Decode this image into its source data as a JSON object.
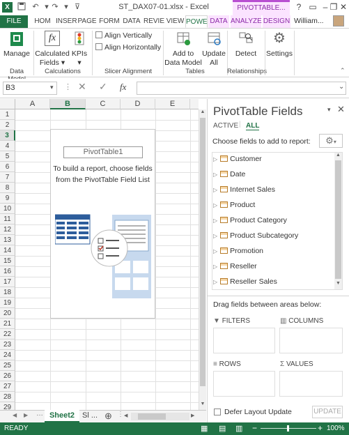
{
  "window": {
    "title": "ST_DAX07-01.xlsx - Excel",
    "context_tab_group": "PIVOTTABLE...",
    "user": "William...",
    "help": "?",
    "minimize": "–",
    "restore": "❐",
    "close": "✕"
  },
  "tabs": [
    "FILE",
    "HOM",
    "INSER",
    "PAGE",
    "FORM",
    "DATA",
    "REVIE",
    "VIEW",
    "POWE",
    "DATA",
    "ANALYZE",
    "DESIGN"
  ],
  "ribbon": {
    "manage": "Manage",
    "data_model": "Data Model",
    "calculated_fields": "Calculated",
    "calculated_fields2": "Fields ▾",
    "kpis": "KPIs",
    "kpis2": "▾",
    "calculations": "Calculations",
    "align_vertically": "Align Vertically",
    "align_horizontally": "Align Horizontally",
    "slicer_alignment": "Slicer Alignment",
    "add_to_data_model": "Add to",
    "add_to_data_model2": "Data Model",
    "update_all": "Update",
    "update_all2": "All",
    "tables": "Tables",
    "detect": "Detect",
    "relationships": "Relationships",
    "settings": "Settings"
  },
  "formula_bar": {
    "name_box": "B3",
    "cancel": "✕",
    "enter": "✓",
    "fx": "fx"
  },
  "grid": {
    "columns": [
      "A",
      "B",
      "C",
      "D",
      "E"
    ],
    "rows": [
      "1",
      "2",
      "3",
      "4",
      "5",
      "6",
      "7",
      "8",
      "9",
      "10",
      "11",
      "12",
      "13",
      "14",
      "15",
      "16",
      "17",
      "18",
      "19",
      "20",
      "21",
      "22",
      "23",
      "24",
      "25",
      "26",
      "27",
      "28",
      "29"
    ],
    "selected_cell": "B3"
  },
  "pivot_placeholder": {
    "name": "PivotTable1",
    "line1": "To build a report, choose fields",
    "line2": "from the PivotTable Field List"
  },
  "sheets": {
    "active": "Sheet2",
    "other": "Sl ...",
    "add": "⊕"
  },
  "pane": {
    "title": "PivotTable Fields",
    "tab_active": "ACTIVE",
    "tab_all": "ALL",
    "choose_label": "Choose fields to add to report:",
    "fields": [
      "Customer",
      "Date",
      "Internet Sales",
      "Product",
      "Product Category",
      "Product Subcategory",
      "Promotion",
      "Reseller",
      "Reseller Sales"
    ],
    "drag_label": "Drag fields between areas below:",
    "filters": "FILTERS",
    "columns": "COLUMNS",
    "rows": "ROWS",
    "values": "VALUES",
    "defer": "Defer Layout Update",
    "update": "UPDATE"
  },
  "status": {
    "text": "READY",
    "zoom": "100%",
    "zoom_minus": "−",
    "zoom_plus": "+"
  },
  "colors": {
    "excel_green": "#217346",
    "context_purple": "#8c2ba8"
  }
}
